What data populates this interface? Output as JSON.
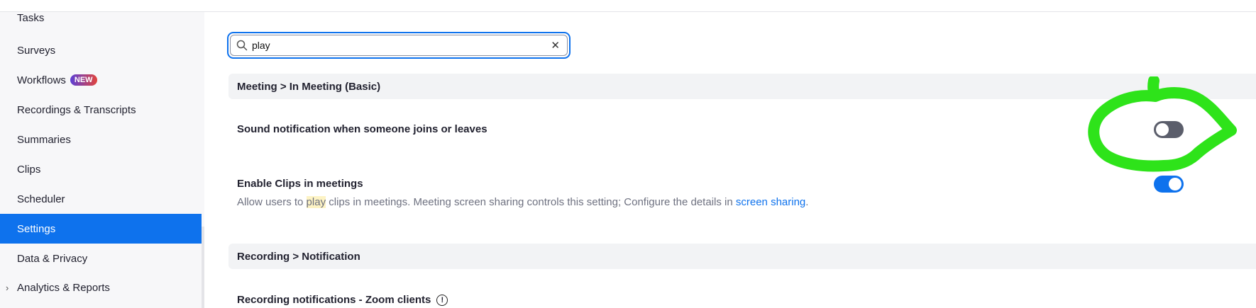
{
  "sidebar": {
    "items": [
      {
        "label": "Tasks"
      },
      {
        "label": "Surveys"
      },
      {
        "label": "Workflows",
        "badge": "NEW"
      },
      {
        "label": "Recordings & Transcripts"
      },
      {
        "label": "Summaries"
      },
      {
        "label": "Clips"
      },
      {
        "label": "Scheduler"
      },
      {
        "label": "Settings",
        "active": true
      },
      {
        "label": "Data & Privacy"
      },
      {
        "label": "Analytics & Reports",
        "expandable": true
      }
    ]
  },
  "search": {
    "value": "play",
    "clear_icon": "close-icon",
    "search_icon": "search-icon"
  },
  "sections": [
    {
      "header": "Meeting > In Meeting (Basic)",
      "settings": [
        {
          "title": "Sound notification when someone joins or leaves",
          "toggle": false
        },
        {
          "title": "Enable Clips in meetings",
          "desc_before": "Allow users to ",
          "desc_highlight": "play",
          "desc_after": " clips in meetings. Meeting screen sharing controls this setting; Configure the details in ",
          "desc_link": "screen sharing",
          "desc_end": ".",
          "toggle": true
        }
      ]
    },
    {
      "header": "Recording > Notification",
      "settings": [
        {
          "title": "Recording notifications - Zoom clients",
          "info_icon": "!"
        }
      ]
    }
  ],
  "colors": {
    "accent": "#0e72ed",
    "annotation": "#2ee31a",
    "badge_start": "#5b3fd6",
    "badge_end": "#e2443c"
  }
}
